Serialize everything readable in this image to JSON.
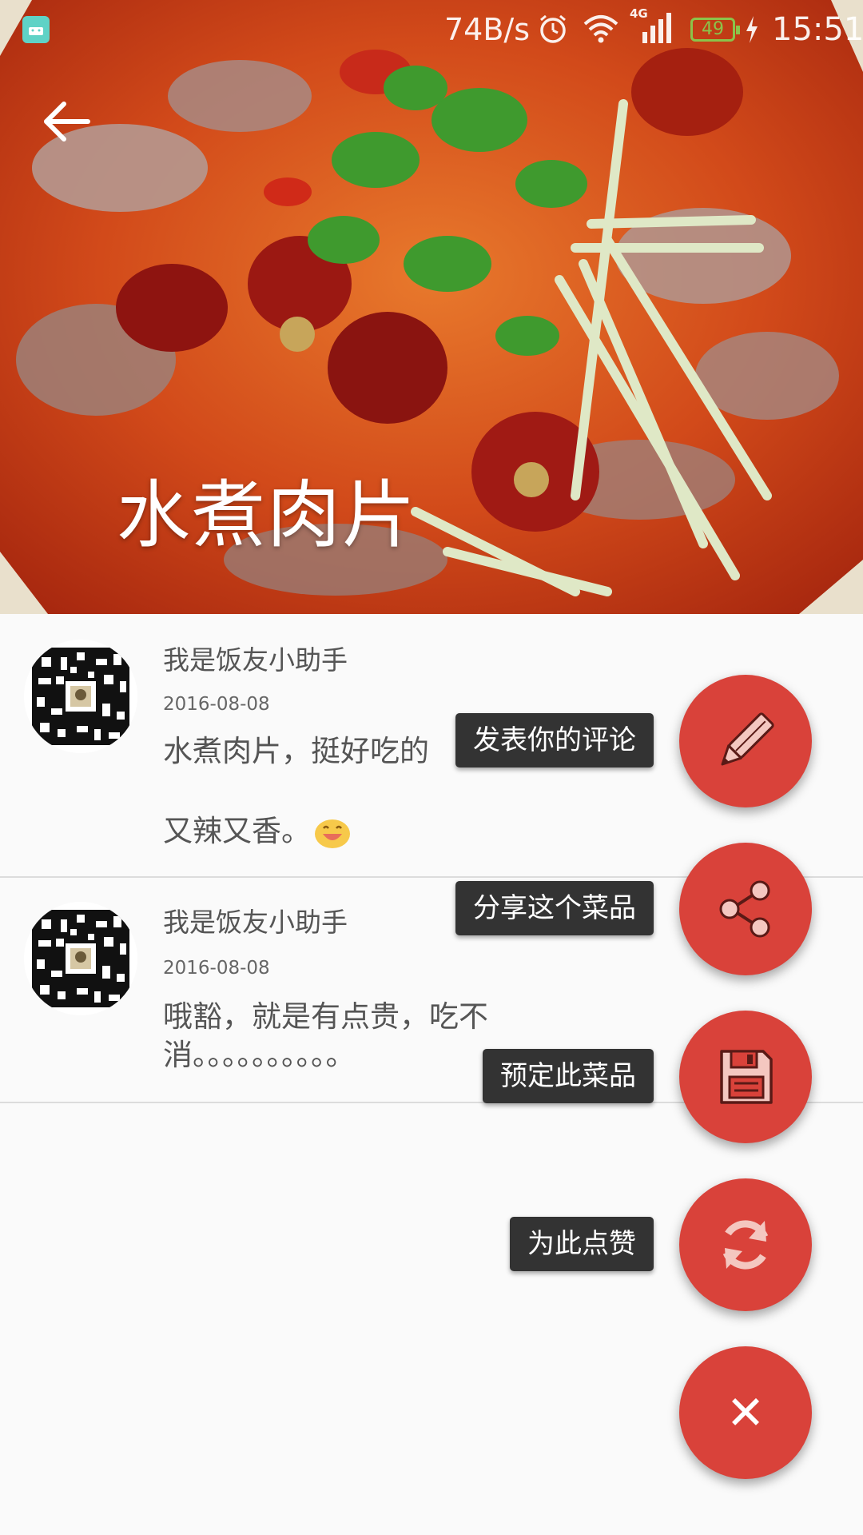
{
  "status_bar": {
    "network_speed": "74B/s",
    "network_type": "4G",
    "battery_level": "49",
    "time": "15:51"
  },
  "dish": {
    "title": "水煮肉片"
  },
  "comments": [
    {
      "author": "我是饭友小助手",
      "date": "2016-08-08",
      "text_line1": "水煮肉片，挺好吃的",
      "text_line2": "又辣又香。"
    },
    {
      "author": "我是饭友小助手",
      "date": "2016-08-08",
      "text": "哦豁，就是有点贵，吃不消。。。。。。。。。。"
    }
  ],
  "fab_menu": {
    "items": [
      {
        "label": "发表你的评论",
        "icon": "pencil-icon"
      },
      {
        "label": "分享这个菜品",
        "icon": "share-icon"
      },
      {
        "label": "预定此菜品",
        "icon": "save-icon"
      },
      {
        "label": "为此点赞",
        "icon": "refresh-icon"
      }
    ],
    "close_glyph": "✕"
  },
  "colors": {
    "fab": "#d9423a",
    "label_bg": "#333333",
    "background": "#fafafa"
  }
}
